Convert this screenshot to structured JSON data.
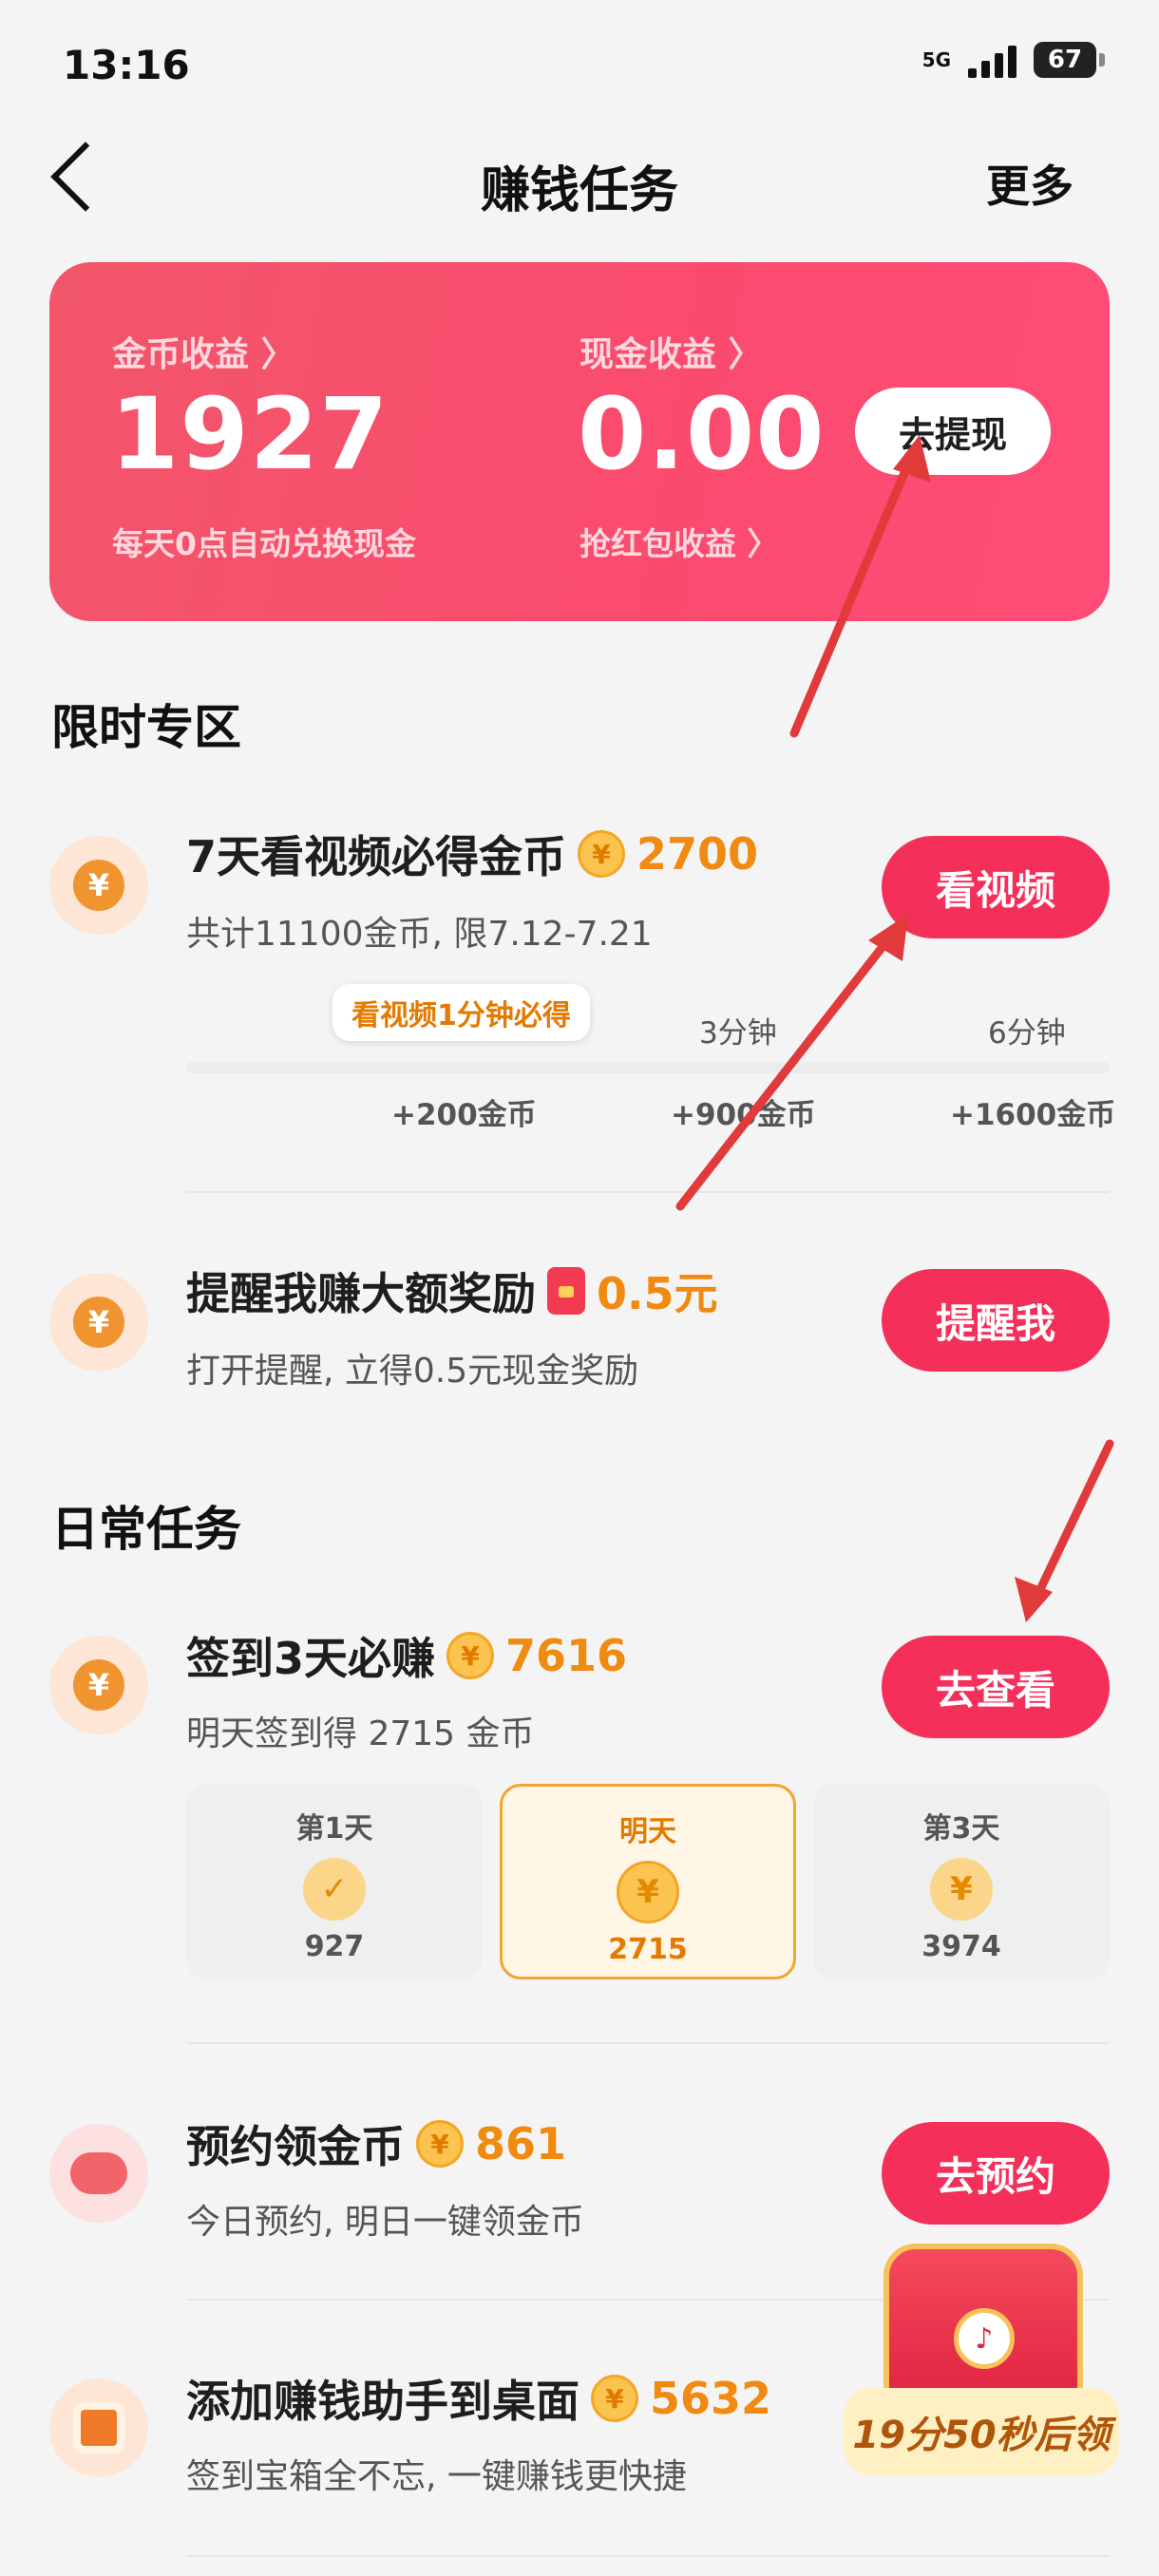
{
  "status": {
    "time": "13:16",
    "network": "5G",
    "battery": "67"
  },
  "nav": {
    "title": "赚钱任务",
    "more": "更多"
  },
  "earnings": {
    "coin_label": "金币收益 〉",
    "coin_value": "1927",
    "coin_note": "每天0点自动兑换现金",
    "cash_label": "现金收益 〉",
    "cash_value": "0.00",
    "cash_note": "抢红包收益 〉",
    "withdraw_button": "去提现"
  },
  "limited": {
    "title": "限时专区",
    "video_task": {
      "title": "7天看视频必得金币",
      "amount": "2700",
      "desc": "共计11100金币, 限7.12-7.21",
      "button": "看视频",
      "bubble": "看视频1分钟必得",
      "milestones": [
        {
          "time": "",
          "reward": "+200金币"
        },
        {
          "time": "3分钟",
          "reward": "+900金币"
        },
        {
          "time": "6分钟",
          "reward": "+1600金币"
        }
      ]
    },
    "remind_task": {
      "title": "提醒我赚大额奖励",
      "amount": "0.5元",
      "desc": "打开提醒, 立得0.5元现金奖励",
      "button": "提醒我"
    }
  },
  "daily": {
    "title": "日常任务",
    "checkin": {
      "title": "签到3天必赚",
      "amount": "7616",
      "desc": "明天签到得 2715 金币",
      "button": "去查看",
      "days": [
        {
          "label": "第1天",
          "value": "927"
        },
        {
          "label": "明天",
          "value": "2715"
        },
        {
          "label": "第3天",
          "value": "3974"
        }
      ]
    },
    "reserve": {
      "title": "预约领金币",
      "amount": "861",
      "desc": "今日预约, 明日一键领金币",
      "button": "去预约"
    },
    "desktop": {
      "title": "添加赚钱助手到桌面",
      "amount": "5632",
      "desc": "签到宝箱全不忘, 一键赚钱更快捷"
    }
  },
  "chest": {
    "timer": "19分50秒后领"
  },
  "icons": {
    "coin_symbol": "¥",
    "check_symbol": "✓"
  },
  "colors": {
    "accent": "#f4305a",
    "card": "#f8506e",
    "gold": "#f08a10",
    "annotation": "#e03a3a"
  }
}
